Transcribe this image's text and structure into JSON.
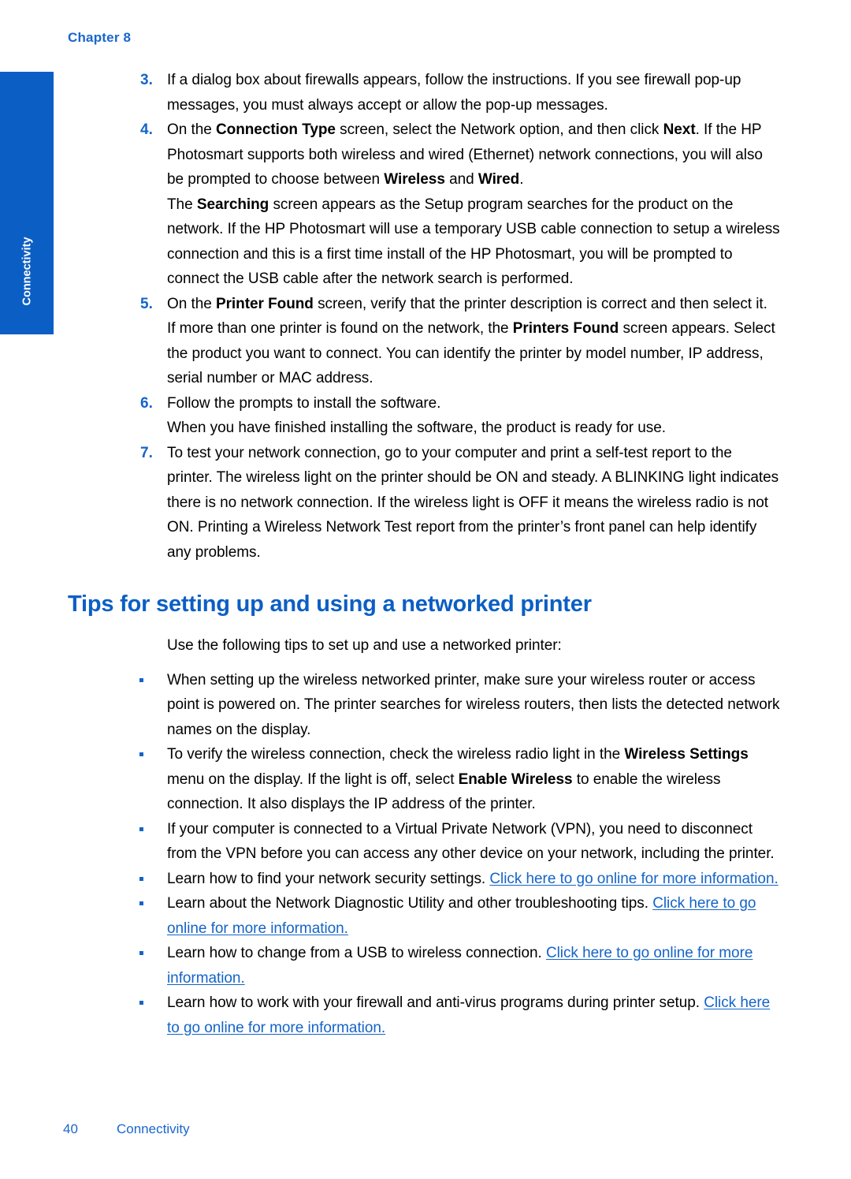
{
  "page": {
    "chapter_label": "Chapter 8",
    "side_tab_label": "Connectivity",
    "side_tab_color": "#0b5fc4",
    "link_color": "#1464c8",
    "heading_color": "#0b5fc4"
  },
  "steps": [
    {
      "number": "3.",
      "paragraphs": [
        {
          "runs": [
            {
              "t": "If a dialog box about firewalls appears, follow the instructions. If you see firewall pop-up messages, you must always accept or allow the pop-up messages.",
              "s": "normal"
            }
          ]
        }
      ]
    },
    {
      "number": "4.",
      "paragraphs": [
        {
          "runs": [
            {
              "t": "On the ",
              "s": "normal"
            },
            {
              "t": "Connection Type",
              "s": "bold"
            },
            {
              "t": " screen, select the Network option, and then click ",
              "s": "normal"
            },
            {
              "t": "Next",
              "s": "bold"
            },
            {
              "t": ". If the HP Photosmart supports both wireless and wired (Ethernet) network connections, you will also be prompted to choose between ",
              "s": "normal"
            },
            {
              "t": "Wireless",
              "s": "bold"
            },
            {
              "t": " and ",
              "s": "normal"
            },
            {
              "t": "Wired",
              "s": "bold"
            },
            {
              "t": ".",
              "s": "normal"
            }
          ]
        },
        {
          "runs": [
            {
              "t": "The ",
              "s": "normal"
            },
            {
              "t": "Searching",
              "s": "bold"
            },
            {
              "t": " screen appears as the Setup program searches for the product on the network. If the HP Photosmart will use a temporary USB cable connection to setup a wireless connection and this is a first time install of the HP Photosmart, you will be prompted to connect the USB cable after the network search is performed.",
              "s": "normal"
            }
          ]
        }
      ]
    },
    {
      "number": "5.",
      "paragraphs": [
        {
          "runs": [
            {
              "t": "On the ",
              "s": "normal"
            },
            {
              "t": "Printer Found",
              "s": "bold"
            },
            {
              "t": " screen, verify that the printer description is correct and then select it.",
              "s": "normal"
            }
          ]
        },
        {
          "runs": [
            {
              "t": "If more than one printer is found on the network, the ",
              "s": "normal"
            },
            {
              "t": "Printers Found",
              "s": "bold"
            },
            {
              "t": " screen appears. Select the product you want to connect. You can identify the printer by model number, IP address, serial number or MAC address.",
              "s": "normal"
            }
          ]
        }
      ]
    },
    {
      "number": "6.",
      "paragraphs": [
        {
          "runs": [
            {
              "t": "Follow the prompts to install the software.",
              "s": "normal"
            }
          ]
        },
        {
          "runs": [
            {
              "t": "When you have finished installing the software, the product is ready for use.",
              "s": "normal"
            }
          ]
        }
      ]
    },
    {
      "number": "7.",
      "paragraphs": [
        {
          "runs": [
            {
              "t": "To test your network connection, go to your computer and print a self-test report to the printer. The wireless light on the printer should be ON and steady. A BLINKING light indicates there is no network connection. If the wireless light is OFF it means the wireless radio is not ON. Printing a Wireless Network Test report from the printer’s front panel can help identify any problems.",
              "s": "normal"
            }
          ]
        }
      ]
    }
  ],
  "section": {
    "title": "Tips for setting up and using a networked printer",
    "intro": "Use the following tips to set up and use a networked printer:",
    "tips": [
      {
        "runs": [
          {
            "t": "When setting up the wireless networked printer, make sure your wireless router or access point is powered on. The printer searches for wireless routers, then lists the detected network names on the display.",
            "s": "normal"
          }
        ]
      },
      {
        "runs": [
          {
            "t": "To verify the wireless connection, check the wireless radio light in the ",
            "s": "normal"
          },
          {
            "t": "Wireless Settings",
            "s": "bold"
          },
          {
            "t": " menu on the display. If the light is off, select ",
            "s": "normal"
          },
          {
            "t": "Enable Wireless",
            "s": "bold"
          },
          {
            "t": " to enable the wireless connection. It also displays the IP address of the printer.",
            "s": "normal"
          }
        ]
      },
      {
        "runs": [
          {
            "t": "If your computer is connected to a Virtual Private Network (VPN), you need to disconnect from the VPN before you can access any other device on your network, including the printer.",
            "s": "normal"
          }
        ]
      },
      {
        "runs": [
          {
            "t": "Learn how to find your network security settings. ",
            "s": "normal"
          },
          {
            "t": "Click here to go online for more information.",
            "s": "link"
          }
        ]
      },
      {
        "runs": [
          {
            "t": "Learn about the Network Diagnostic Utility and other troubleshooting tips. ",
            "s": "normal"
          },
          {
            "t": "Click here to go online for more information.",
            "s": "link"
          }
        ]
      },
      {
        "runs": [
          {
            "t": "Learn how to change from a USB to wireless connection. ",
            "s": "normal"
          },
          {
            "t": "Click here to go online for more information.",
            "s": "link"
          }
        ]
      },
      {
        "runs": [
          {
            "t": "Learn how to work with your firewall and anti-virus programs during printer setup. ",
            "s": "normal"
          },
          {
            "t": "Click here to go online for more information.",
            "s": "link"
          }
        ]
      }
    ]
  },
  "footer": {
    "page_number": "40",
    "section_name": "Connectivity"
  }
}
